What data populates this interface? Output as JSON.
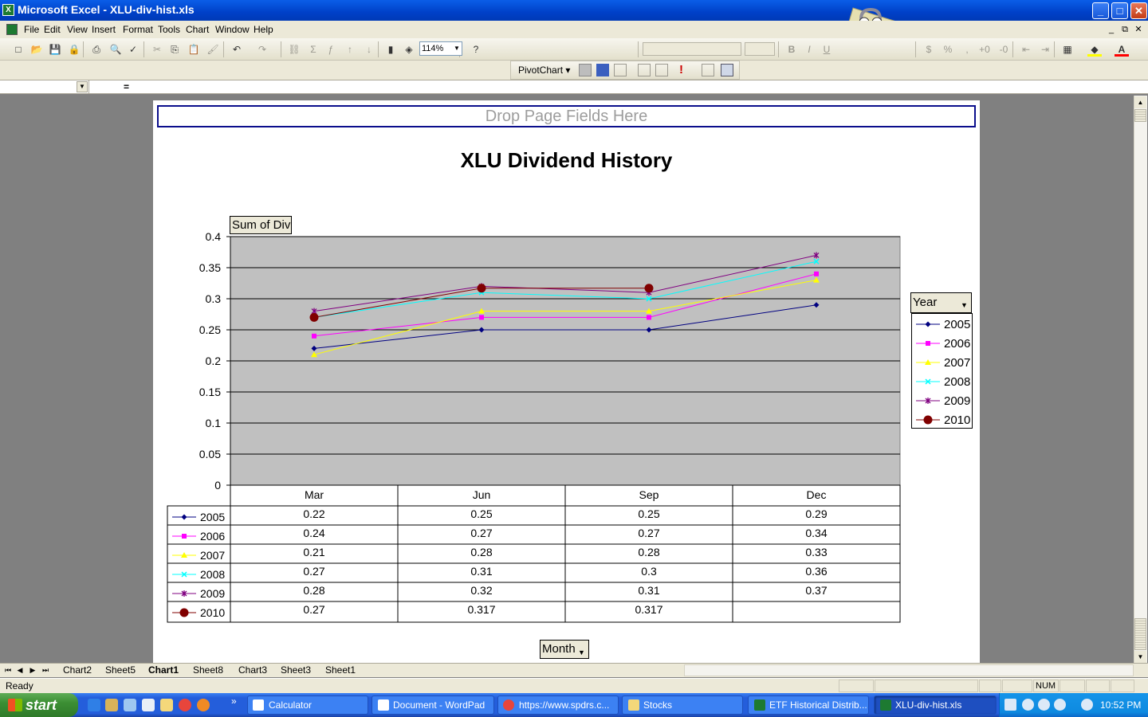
{
  "window": {
    "title": "Microsoft Excel - XLU-div-hist.xls",
    "controls": {
      "minimize": "_",
      "maximize": "□",
      "close": "✕"
    }
  },
  "menu": {
    "items": [
      "File",
      "Edit",
      "View",
      "Insert",
      "Format",
      "Tools",
      "Chart",
      "Window",
      "Help"
    ],
    "doc_controls": [
      "_",
      "⧉",
      "✕"
    ]
  },
  "toolbar": {
    "zoom": "114%",
    "font_name": "",
    "font_size": "",
    "icons": [
      "new-icon",
      "open-icon",
      "save-icon",
      "permission-icon",
      "print-icon",
      "print-preview-icon",
      "spelling-icon",
      "cut-icon",
      "copy-icon",
      "paste-icon",
      "format-painter-icon",
      "undo-icon",
      "redo-icon",
      "hyperlink-icon",
      "autosum-icon",
      "function-icon",
      "sort-ascending-icon",
      "sort-descending-icon",
      "chart-wizard-icon",
      "drawing-icon",
      "help-icon",
      "bold-icon",
      "italic-icon",
      "underline-icon",
      "currency-icon",
      "percent-icon",
      "comma-icon",
      "increase-decimal-icon",
      "decrease-decimal-icon",
      "decrease-indent-icon",
      "increase-indent-icon",
      "borders-icon",
      "fill-color-icon",
      "font-color-icon"
    ],
    "fill_color": "#ffff00",
    "font_color": "#ff0000"
  },
  "pivot_toolbar": {
    "label": "PivotChart ▾"
  },
  "formula_bar": {
    "name_box": "",
    "equals": "="
  },
  "pivot": {
    "drop_page_fields": "Drop Page Fields Here",
    "data_field": "Sum of Div",
    "series_field": "Year",
    "category_field": "Month"
  },
  "chart_data": {
    "type": "line",
    "title": "XLU Dividend History",
    "categories": [
      "Mar",
      "Jun",
      "Sep",
      "Dec"
    ],
    "ylim": [
      0,
      0.4
    ],
    "yticks": [
      "0",
      "0.05",
      "0.1",
      "0.15",
      "0.2",
      "0.25",
      "0.3",
      "0.35",
      "0.4"
    ],
    "grid": true,
    "legend": "right",
    "series": [
      {
        "name": "2005",
        "color": "#000080",
        "marker": "diamond",
        "values": [
          0.22,
          0.25,
          0.25,
          0.29
        ],
        "labels": [
          "0.22",
          "0.25",
          "0.25",
          "0.29"
        ]
      },
      {
        "name": "2006",
        "color": "#ff00ff",
        "marker": "square",
        "values": [
          0.24,
          0.27,
          0.27,
          0.34
        ],
        "labels": [
          "0.24",
          "0.27",
          "0.27",
          "0.34"
        ]
      },
      {
        "name": "2007",
        "color": "#ffff00",
        "marker": "triangle",
        "values": [
          0.21,
          0.28,
          0.28,
          0.33
        ],
        "labels": [
          "0.21",
          "0.28",
          "0.28",
          "0.33"
        ]
      },
      {
        "name": "2008",
        "color": "#00ffff",
        "marker": "x",
        "values": [
          0.27,
          0.31,
          0.3,
          0.36
        ],
        "labels": [
          "0.27",
          "0.31",
          "0.3",
          "0.36"
        ]
      },
      {
        "name": "2009",
        "color": "#800080",
        "marker": "star",
        "values": [
          0.28,
          0.32,
          0.31,
          0.37
        ],
        "labels": [
          "0.28",
          "0.32",
          "0.31",
          "0.37"
        ]
      },
      {
        "name": "2010",
        "color": "#800000",
        "marker": "circle",
        "values": [
          0.27,
          0.317,
          0.317,
          null
        ],
        "labels": [
          "0.27",
          "0.317",
          "0.317",
          ""
        ]
      }
    ]
  },
  "sheet_tabs": {
    "tabs": [
      "Chart2",
      "Sheet5",
      "Chart1",
      "Sheet8",
      "Chart3",
      "Sheet3",
      "Sheet1"
    ],
    "active": "Chart1"
  },
  "status": {
    "text": "Ready",
    "num": "NUM"
  },
  "taskbar": {
    "start": "start",
    "buttons": [
      "Calculator",
      "Document - WordPad",
      "https://www.spdrs.c...",
      "Stocks",
      "ETF Historical Distrib...",
      "XLU-div-hist.xls"
    ],
    "active": "XLU-div-hist.xls",
    "clock": "10:52 PM"
  }
}
